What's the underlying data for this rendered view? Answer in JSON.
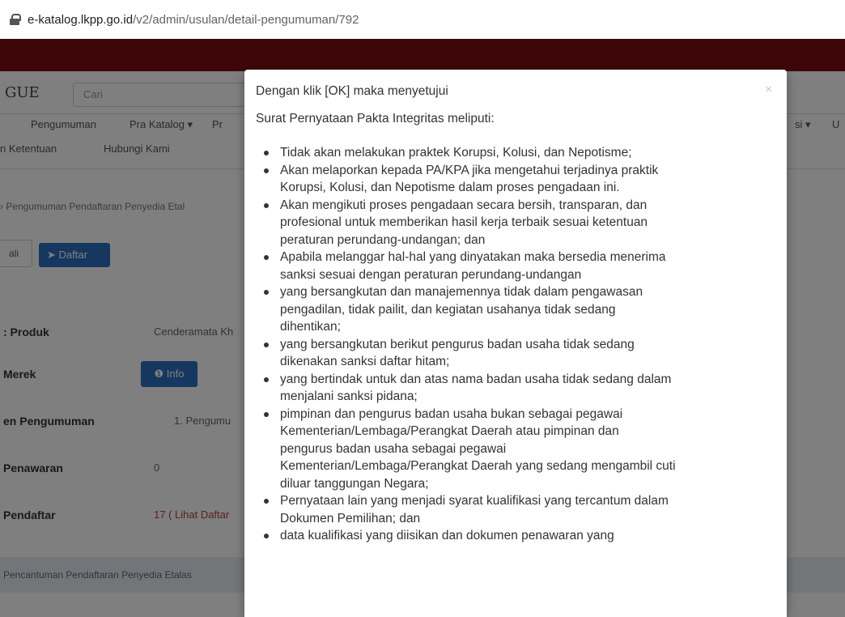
{
  "browser": {
    "url_host": "e-katalog.lkpp.go.id",
    "url_path": "/v2/admin/usulan/detail-pengumuman/792"
  },
  "page": {
    "logo": "GUE",
    "search_placeholder": "Cari",
    "nav1": [
      "Pengumuman",
      "Pra Katalog ▾",
      "Pr",
      "si ▾",
      "U"
    ],
    "nav2": [
      "n Ketentuan",
      "Hubungi Kami"
    ],
    "breadcrumb": "› Pengumuman Pendaftaran Penyedia Etal",
    "btn_back": "ali",
    "btn_daftar": "Daftar",
    "rows": [
      {
        "label": ": Produk",
        "value": "Cenderamata Kh"
      },
      {
        "label": "Merek",
        "value": "Info"
      },
      {
        "label": "en Pengumuman",
        "value": "1. Pengumu"
      },
      {
        "label": "Penawaran",
        "value": "0"
      },
      {
        "label": "Pendaftar",
        "value": "17 ( Lihat Daftar"
      }
    ],
    "band_text": "Pencantuman Pendaftaran Penyedia Etalas"
  },
  "modal": {
    "line1": "Dengan klik [OK] maka menyetujui",
    "line2": "Surat Pernyataan Pakta Integritas meliputi:",
    "close": "×",
    "items": [
      [
        "Tidak akan melakukan praktek Korupsi, Kolusi, dan Nepotisme;"
      ],
      [
        "Akan melaporkan kepada PA/KPA jika mengetahui terjadinya praktik",
        "Korupsi, Kolusi, dan Nepotisme dalam proses pengadaan ini."
      ],
      [
        "Akan mengikuti proses pengadaan secara bersih, transparan, dan",
        "profesional untuk memberikan hasil kerja terbaik sesuai ketentuan",
        "peraturan perundang-undangan; dan"
      ],
      [
        "Apabila melanggar hal-hal yang dinyatakan maka bersedia menerima",
        "sanksi sesuai dengan peraturan perundang-undangan"
      ],
      [
        "yang bersangkutan dan manajemennya tidak dalam pengawasan",
        "pengadilan, tidak pailit, dan kegiatan usahanya tidak sedang",
        "dihentikan;"
      ],
      [
        "yang bersangkutan berikut pengurus badan usaha tidak sedang",
        "dikenakan sanksi daftar hitam;"
      ],
      [
        "yang bertindak untuk dan atas nama badan usaha tidak sedang dalam",
        "menjalani sanksi pidana;"
      ],
      [
        "pimpinan dan pengurus badan usaha bukan sebagai pegawai",
        "Kementerian/Lembaga/Perangkat Daerah atau pimpinan dan",
        "pengurus badan usaha sebagai pegawai",
        "Kementerian/Lembaga/Perangkat Daerah yang sedang mengambil cuti",
        "diluar tanggungan Negara;"
      ],
      [
        "Pernyataan lain yang menjadi syarat kualifikasi yang tercantum dalam",
        "Dokumen Pemilihan; dan"
      ],
      [
        "data kualifikasi yang diisikan dan dokumen penawaran yang"
      ]
    ]
  }
}
